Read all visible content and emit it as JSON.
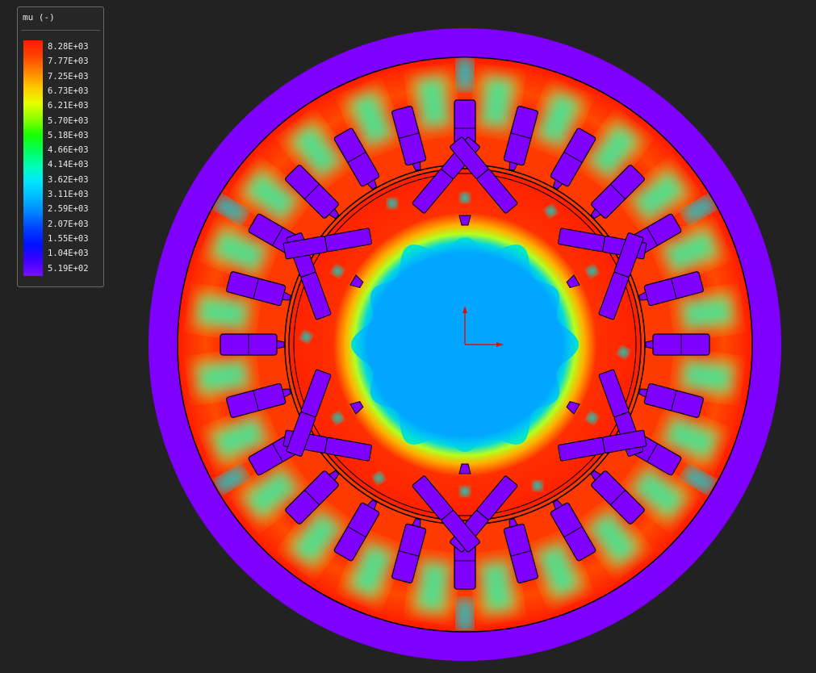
{
  "legend": {
    "title": "mu (-)",
    "labels": [
      "8.28E+03",
      "7.77E+03",
      "7.25E+03",
      "6.73E+03",
      "6.21E+03",
      "5.70E+03",
      "5.18E+03",
      "4.66E+03",
      "4.14E+03",
      "3.62E+03",
      "3.11E+03",
      "2.59E+03",
      "2.07E+03",
      "1.55E+03",
      "1.04E+03",
      "5.19E+02"
    ],
    "colors": [
      "#ff1a00",
      "#ff4200",
      "#ff8400",
      "#ffc800",
      "#e6ff00",
      "#8cff00",
      "#19ff00",
      "#00ff5a",
      "#00ffb4",
      "#00e6ff",
      "#00b8ff",
      "#0080ff",
      "#0040ff",
      "#0010ff",
      "#3c00ff",
      "#7a0fff"
    ]
  },
  "model": {
    "stator_slots": 24,
    "rotor_poles": 6,
    "colors": {
      "outer_ring": "#7f00ff",
      "high": "#ff2200",
      "mid_high": "#ff8c00",
      "mid": "#c8ff00",
      "mid_low": "#00e0d0",
      "low": "#00a0ff",
      "magnet": "#7f00ff",
      "outline": "#000000"
    }
  },
  "axes": {
    "x_color": "#e01010",
    "y_color": "#e01010"
  }
}
